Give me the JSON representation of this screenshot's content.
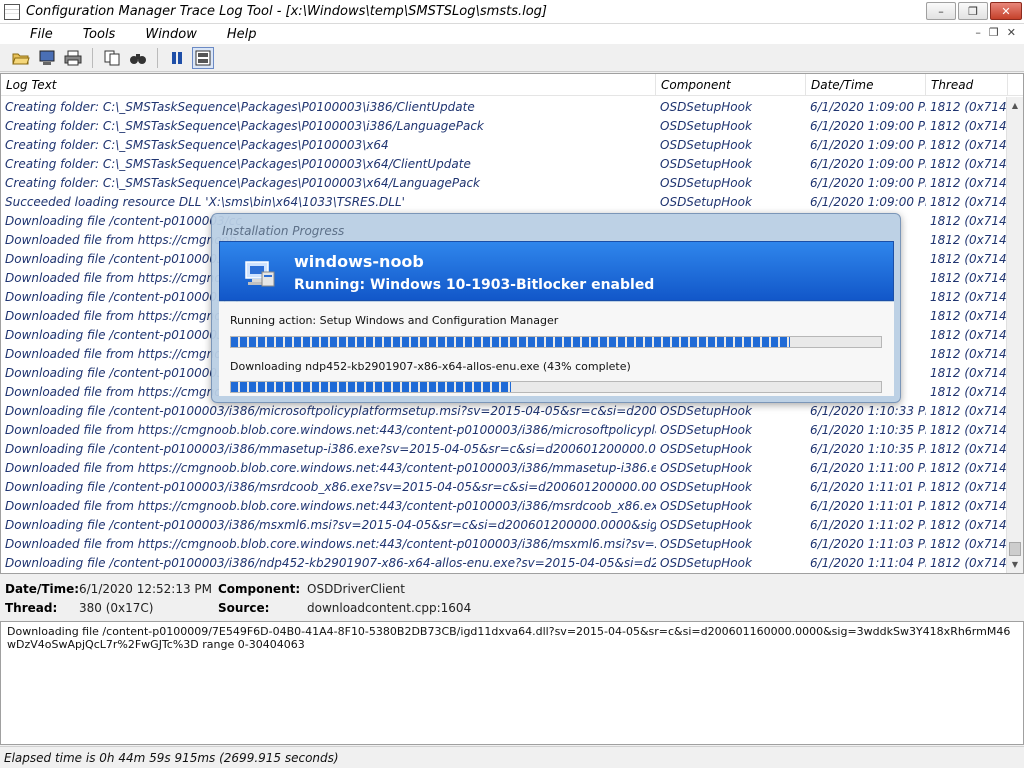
{
  "window": {
    "title": "Configuration Manager Trace Log Tool - [x:\\Windows\\temp\\SMSTSLog\\smsts.log]"
  },
  "menu": {
    "items": [
      "File",
      "Tools",
      "Window",
      "Help"
    ]
  },
  "toolbar": {
    "buttons": [
      "open-icon",
      "computer-icon",
      "print-icon",
      "copy-icon",
      "find-icon",
      "pause-icon",
      "details-icon"
    ]
  },
  "log": {
    "columns": {
      "text": "Log Text",
      "component": "Component",
      "datetime": "Date/Time",
      "thread": "Thread"
    },
    "rows": [
      {
        "text": "Creating folder: C:\\_SMSTaskSequence\\Packages\\P0100003\\i386/ClientUpdate",
        "component": "OSDSetupHook",
        "datetime": "6/1/2020 1:09:00 PM",
        "thread": "1812 (0x714)"
      },
      {
        "text": "Creating folder: C:\\_SMSTaskSequence\\Packages\\P0100003\\i386/LanguagePack",
        "component": "OSDSetupHook",
        "datetime": "6/1/2020 1:09:00 PM",
        "thread": "1812 (0x714)"
      },
      {
        "text": "Creating folder: C:\\_SMSTaskSequence\\Packages\\P0100003\\x64",
        "component": "OSDSetupHook",
        "datetime": "6/1/2020 1:09:00 PM",
        "thread": "1812 (0x714)"
      },
      {
        "text": "Creating folder: C:\\_SMSTaskSequence\\Packages\\P0100003\\x64/ClientUpdate",
        "component": "OSDSetupHook",
        "datetime": "6/1/2020 1:09:00 PM",
        "thread": "1812 (0x714)"
      },
      {
        "text": "Creating folder: C:\\_SMSTaskSequence\\Packages\\P0100003\\x64/LanguagePack",
        "component": "OSDSetupHook",
        "datetime": "6/1/2020 1:09:00 PM",
        "thread": "1812 (0x714)"
      },
      {
        "text": "Succeeded loading resource DLL 'X:\\sms\\bin\\x64\\1033\\TSRES.DLL'",
        "component": "OSDSetupHook",
        "datetime": "6/1/2020 1:09:00 PM",
        "thread": "1812 (0x714)"
      },
      {
        "text": "Downloading file /content-p0100003/cc",
        "component": "",
        "datetime": "",
        "thread": "1812 (0x714)"
      },
      {
        "text": "Downloaded file from https://cmgnoob",
        "component": "",
        "datetime": "",
        "thread": "1812 (0x714)"
      },
      {
        "text": "Downloading file /content-p0100003/cc",
        "component": "",
        "datetime": "",
        "thread": "1812 (0x714)"
      },
      {
        "text": "Downloaded file from https://cmgnoob",
        "component": "",
        "datetime": "",
        "thread": "1812 (0x714)"
      },
      {
        "text": "Downloading file /content-p0100003/ep",
        "component": "",
        "datetime": "",
        "thread": "1812 (0x714)"
      },
      {
        "text": "Downloaded file from https://cmgnoob",
        "component": "",
        "datetime": "",
        "thread": "1812 (0x714)"
      },
      {
        "text": "Downloading file /content-p0100003/i3",
        "component": "",
        "datetime": "",
        "thread": "1812 (0x714)"
      },
      {
        "text": "Downloaded file from https://cmgnoob",
        "component": "",
        "datetime": "",
        "thread": "1812 (0x714)"
      },
      {
        "text": "Downloading file /content-p0100003/i3",
        "component": "",
        "datetime": "",
        "thread": "1812 (0x714)"
      },
      {
        "text": "Downloaded file from https://cmgnoob",
        "component": "",
        "datetime": "",
        "thread": "1812 (0x714)"
      },
      {
        "text": "Downloading file /content-p0100003/i386/microsoftpolicyplatformsetup.msi?sv=2015-04-05&sr=c&si=d200601200000.0000...",
        "component": "OSDSetupHook",
        "datetime": "6/1/2020 1:10:33 PM",
        "thread": "1812 (0x714)"
      },
      {
        "text": "Downloaded file from https://cmgnoob.blob.core.windows.net:443/content-p0100003/i386/microsoftpolicyplatformsetup.m...",
        "component": "OSDSetupHook",
        "datetime": "6/1/2020 1:10:35 PM",
        "thread": "1812 (0x714)"
      },
      {
        "text": "Downloading file /content-p0100003/i386/mmasetup-i386.exe?sv=2015-04-05&sr=c&si=d200601200000.0000&sig=WV93...",
        "component": "OSDSetupHook",
        "datetime": "6/1/2020 1:10:35 PM",
        "thread": "1812 (0x714)"
      },
      {
        "text": "Downloaded file from https://cmgnoob.blob.core.windows.net:443/content-p0100003/i386/mmasetup-i386.exe?sv=2015-0...",
        "component": "OSDSetupHook",
        "datetime": "6/1/2020 1:11:00 PM",
        "thread": "1812 (0x714)"
      },
      {
        "text": "Downloading file /content-p0100003/i386/msrdcoob_x86.exe?sv=2015-04-05&sr=c&si=d200601200000.0000&sig=WV93H...",
        "component": "OSDSetupHook",
        "datetime": "6/1/2020 1:11:01 PM",
        "thread": "1812 (0x714)"
      },
      {
        "text": "Downloaded file from https://cmgnoob.blob.core.windows.net:443/content-p0100003/i386/msrdcoob_x86.exe?sv=2015-04-...",
        "component": "OSDSetupHook",
        "datetime": "6/1/2020 1:11:01 PM",
        "thread": "1812 (0x714)"
      },
      {
        "text": "Downloading file /content-p0100003/i386/msxml6.msi?sv=2015-04-05&sr=c&si=d200601200000.0000&sig=WV93H%2F45x...",
        "component": "OSDSetupHook",
        "datetime": "6/1/2020 1:11:02 PM",
        "thread": "1812 (0x714)"
      },
      {
        "text": "Downloaded file from https://cmgnoob.blob.core.windows.net:443/content-p0100003/i386/msxml6.msi?sv=2015-04-05&sr...",
        "component": "OSDSetupHook",
        "datetime": "6/1/2020 1:11:03 PM",
        "thread": "1812 (0x714)"
      },
      {
        "text": "Downloading file /content-p0100003/i386/ndp452-kb2901907-x86-x64-allos-enu.exe?sv=2015-04-05&si=d200601200...",
        "component": "OSDSetupHook",
        "datetime": "6/1/2020 1:11:04 PM",
        "thread": "1812 (0x714)"
      }
    ]
  },
  "details": {
    "datetime_label": "Date/Time:",
    "datetime_value": "6/1/2020 12:52:13 PM",
    "component_label": "Component:",
    "component_value": "OSDDriverClient",
    "thread_label": "Thread:",
    "thread_value": "380 (0x17C)",
    "source_label": "Source:",
    "source_value": "downloadcontent.cpp:1604"
  },
  "message": "Downloading file /content-p0100009/7E549F6D-04B0-41A4-8F10-5380B2DB73CB/igd11dxva64.dll?sv=2015-04-05&sr=c&si=d200601160000.0000&sig=3wddkSw3Y418xRh6rmM46wDzV4oSwApjQcL7r%2FwGJTc%3D range 0-30404063",
  "status": "Elapsed time is 0h 44m 59s 915ms (2699.915 seconds)",
  "dialog": {
    "title": "Installation Progress",
    "organization": "windows-noob",
    "running": "Running: Windows 10-1903-Bitlocker enabled",
    "action": "Running action: Setup Windows and Configuration Manager",
    "action_progress": 0.86,
    "download": "Downloading ndp452-kb2901907-x86-x64-allos-enu.exe (43% complete)",
    "download_progress": 0.43
  }
}
